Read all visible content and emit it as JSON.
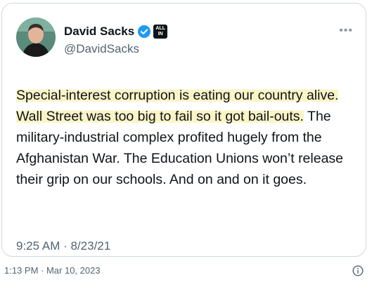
{
  "tweet": {
    "author": {
      "name": "David Sacks",
      "handle": "@DavidSacks",
      "badge_text": "ALL IN"
    },
    "text_highlighted": "Special-interest corruption is eating our country alive. Wall Street was too big to fail so it got bail-outs.",
    "text_rest": " The military-industrial complex profited hugely from the Afghanistan War. The Education Unions won’t release their grip on our schools. And on and on it goes.",
    "timestamp": "9:25 AM · 8/23/21"
  },
  "footer": {
    "capture_time": "1:13 PM · Mar 10, 2023"
  },
  "colors": {
    "highlight": "#fbf4c6",
    "verified": "#1d9bf0",
    "text": "#0f1419",
    "muted": "#536471"
  },
  "icons": [
    "verified-icon",
    "more-icon",
    "info-icon"
  ]
}
